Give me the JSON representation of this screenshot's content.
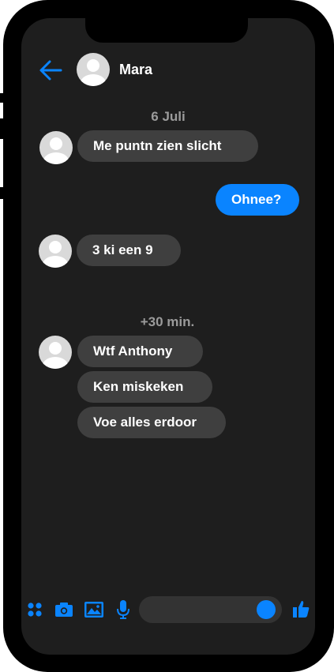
{
  "header": {
    "contact_name": "Mara",
    "back_icon": "arrow-left-icon"
  },
  "conversation": {
    "timestamp_1": "6 Juli",
    "timestamp_2": "+30 min.",
    "messages": [
      {
        "sender": "Mara",
        "text": "Me puntn zien slicht"
      },
      {
        "sender": "me",
        "text": "Ohnee?"
      },
      {
        "sender": "Mara",
        "text": "3 ki een 9"
      },
      {
        "sender": "Mara",
        "text": "Wtf Anthony"
      },
      {
        "sender": "Mara",
        "text": "Ken miskeken"
      },
      {
        "sender": "Mara",
        "text": "Voe alles erdoor"
      }
    ]
  },
  "toolbar": {
    "icons": [
      "apps-icon",
      "camera-icon",
      "image-icon",
      "microphone-icon",
      "thumbs-up-icon"
    ],
    "message_input_value": ""
  },
  "colors": {
    "accent": "#0a84ff",
    "incoming_bubble": "#3f3f3f",
    "screen_background": "#1e1e1e"
  }
}
